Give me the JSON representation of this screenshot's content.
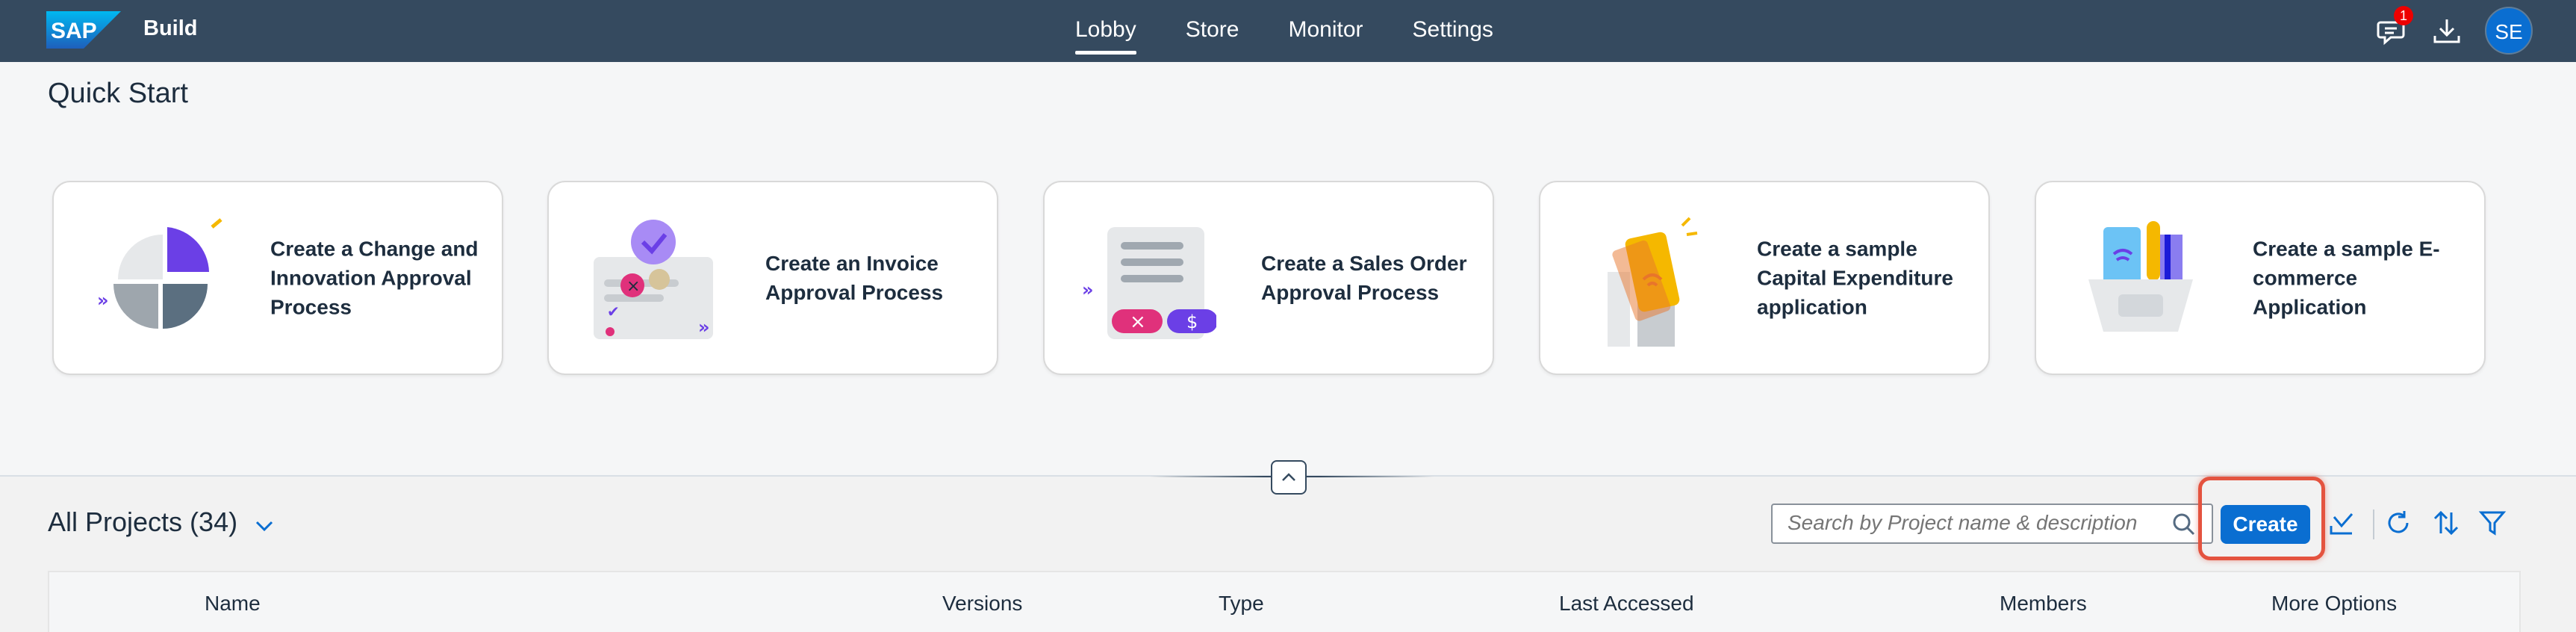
{
  "shell": {
    "brand": "SAP",
    "product": "Build",
    "nav": [
      {
        "label": "Lobby",
        "active": true
      },
      {
        "label": "Store",
        "active": false
      },
      {
        "label": "Monitor",
        "active": false
      },
      {
        "label": "Settings",
        "active": false
      }
    ],
    "notification_count": "1",
    "avatar_initials": "SE"
  },
  "quick_start": {
    "title": "Quick Start",
    "cards": [
      {
        "label": "Create a Change and Innovation Approval Process",
        "icon": "pie-chart-illustration"
      },
      {
        "label": "Create an Invoice Approval Process",
        "icon": "invoice-illustration"
      },
      {
        "label": "Create a Sales Order Approval Process",
        "icon": "sales-order-illustration"
      },
      {
        "label": "Create a sample Capital Expenditure application",
        "icon": "capex-illustration"
      },
      {
        "label": "Create a sample E-commerce Application",
        "icon": "ecommerce-basket-illustration"
      }
    ]
  },
  "projects": {
    "title": "All Projects (34)",
    "search_placeholder": "Search by Project name & description",
    "create_label": "Create",
    "columns": [
      "Name",
      "Versions",
      "Type",
      "Last Accessed",
      "Members",
      "More Options"
    ]
  },
  "colors": {
    "shell": "#354a5f",
    "accent": "#0a6ed1",
    "highlight": "#e4533f"
  }
}
